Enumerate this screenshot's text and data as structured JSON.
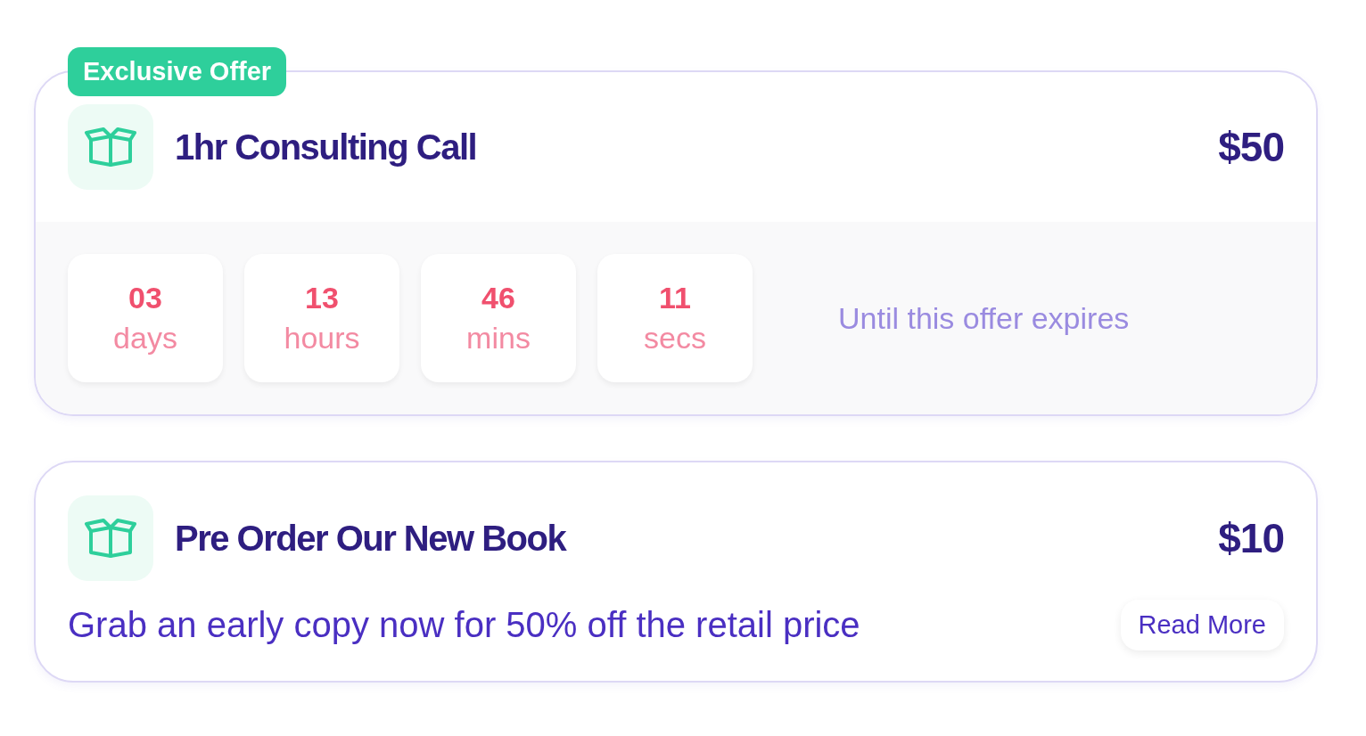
{
  "offers": [
    {
      "kind": "countdown",
      "badge": "Exclusive Offer",
      "title": "1hr Consulting Call",
      "price": "$50",
      "countdown": [
        {
          "value": "03",
          "unit": "days"
        },
        {
          "value": "13",
          "unit": "hours"
        },
        {
          "value": "46",
          "unit": "mins"
        },
        {
          "value": "11",
          "unit": "secs"
        }
      ],
      "note": "Until this offer expires"
    },
    {
      "kind": "description",
      "title": "Pre Order Our New Book",
      "price": "$10",
      "description": "Grab an early copy now for 50% off the retail price",
      "button": "Read More"
    }
  ]
}
